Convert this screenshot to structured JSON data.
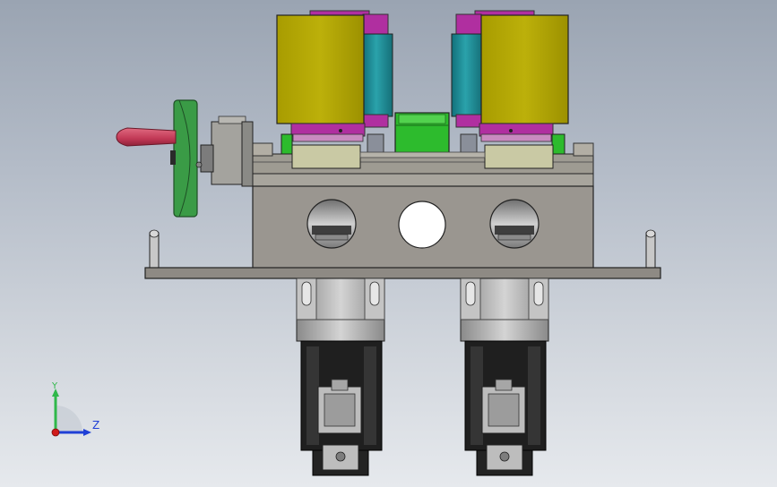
{
  "viewport": {
    "background_top": "#9aa4b2",
    "background_bottom": "#e6e9ed"
  },
  "triad": {
    "y_label": "Y",
    "z_label": "Z",
    "y_color": "#2fb84a",
    "z_color": "#1f3fd6",
    "x_color": "#d01a1a"
  },
  "model": {
    "colors": {
      "solenoid_yellow": "#b2a600",
      "cylinder_teal": "#1e8e96",
      "fitting_magenta": "#b02fa0",
      "block_green": "#2dbb2d",
      "pad_khaki": "#c9c9a4",
      "body_gray": "#9a9690",
      "plate_gray": "#8e8a84",
      "handwheel_green": "#3a9b46",
      "handle_red": "#c83c5a",
      "motor_black": "#1f1f1f",
      "gearbox_gray": "#b6b6b6"
    }
  }
}
